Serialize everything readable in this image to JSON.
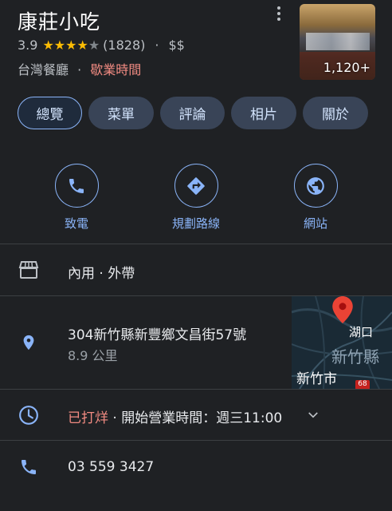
{
  "place": {
    "name": "康莊小吃",
    "rating": "3.9",
    "stars": 4,
    "review_count": "(1828)",
    "dot": "·",
    "price": "$$",
    "category": "台灣餐廳",
    "hours_link": "歇業時間",
    "photo_count": "1,120+"
  },
  "tabs": [
    {
      "label": "總覽",
      "active": true
    },
    {
      "label": "菜單",
      "active": false
    },
    {
      "label": "評論",
      "active": false
    },
    {
      "label": "相片",
      "active": false
    },
    {
      "label": "關於",
      "active": false
    }
  ],
  "actions": {
    "call": {
      "label": "致電",
      "icon": "phone-icon"
    },
    "directions": {
      "label": "規劃路線",
      "icon": "directions-icon"
    },
    "website": {
      "label": "網站",
      "icon": "globe-icon"
    }
  },
  "info": {
    "service": "內用 · 外帶",
    "address": "304新竹縣新豐鄉文昌街57號",
    "distance": "8.9 公里",
    "hours_status": "已打烊",
    "hours_detail": " · 開始營業時間：週三11:00",
    "phone": "03 559 3427"
  },
  "map": {
    "label_1": "湖口",
    "label_2": "新竹縣",
    "label_3": "新竹市",
    "road_badge": "68"
  },
  "colors": {
    "background": "#1f2124",
    "accent": "#8ab4f8",
    "tab_bg": "#394457",
    "star": "#fbbc04",
    "closed": "#f28b82",
    "pin": "#ea4335"
  }
}
